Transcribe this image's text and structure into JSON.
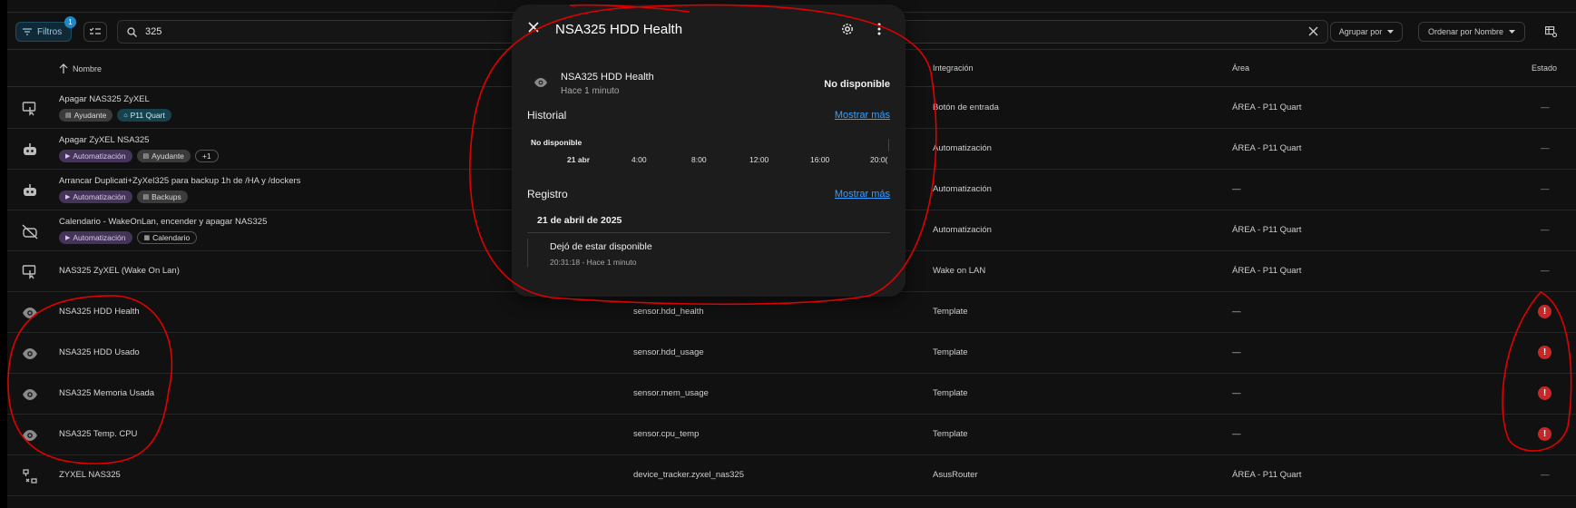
{
  "toolbar": {
    "filters_label": "Filtros",
    "filters_badge": "1",
    "search_value": "325",
    "group_label": "Agrupar por",
    "sort_label": "Ordenar por Nombre"
  },
  "table": {
    "headers": {
      "name": "Nombre",
      "integration": "Integración",
      "area": "Área",
      "state": "Estado"
    },
    "rows": [
      {
        "icon": "button-press-icon",
        "name": "Apagar NAS325 ZyXEL",
        "entity_id": "",
        "integration": "Botón de entrada",
        "area": "ÁREA - P11 Quart",
        "state": "—",
        "labels": [
          {
            "text": "Ayudante",
            "style": "gray"
          },
          {
            "text": "P11 Quart",
            "style": "teal"
          }
        ]
      },
      {
        "icon": "robot-icon",
        "name": "Apagar ZyXEL NSA325",
        "entity_id": "",
        "integration": "Automatización",
        "area": "ÁREA - P11 Quart",
        "state": "—",
        "labels": [
          {
            "text": "Automatización",
            "style": "purple"
          },
          {
            "text": "Ayudante",
            "style": "gray"
          },
          {
            "text": "+1",
            "style": "outline"
          }
        ]
      },
      {
        "icon": "robot-icon",
        "name": "Arrancar Duplicati+ZyXel325 para backup 1h de /HA y /dockers",
        "entity_id": "",
        "integration": "Automatización",
        "area": "—",
        "state": "—",
        "labels": [
          {
            "text": "Automatización",
            "style": "purple"
          },
          {
            "text": "Backups",
            "style": "gray"
          }
        ]
      },
      {
        "icon": "robot-off-icon",
        "name": "Calendario - WakeOnLan, encender y apagar NAS325",
        "entity_id": "",
        "integration": "Automatización",
        "area": "ÁREA - P11 Quart",
        "state": "—",
        "labels": [
          {
            "text": "Automatización",
            "style": "purple"
          },
          {
            "text": "Calendario",
            "style": "outline"
          }
        ]
      },
      {
        "icon": "button-press-icon",
        "name": "NAS325 ZyXEL (Wake On Lan)",
        "entity_id": "",
        "integration": "Wake on LAN",
        "area": "ÁREA - P11 Quart",
        "state": "—",
        "labels": []
      },
      {
        "icon": "eye-icon",
        "name": "NSA325 HDD Health",
        "entity_id": "sensor.hdd_health",
        "integration": "Template",
        "area": "—",
        "state": "!",
        "labels": []
      },
      {
        "icon": "eye-icon",
        "name": "NSA325 HDD Usado",
        "entity_id": "sensor.hdd_usage",
        "integration": "Template",
        "area": "—",
        "state": "!",
        "labels": []
      },
      {
        "icon": "eye-icon",
        "name": "NSA325 Memoria Usada",
        "entity_id": "sensor.mem_usage",
        "integration": "Template",
        "area": "—",
        "state": "!",
        "labels": []
      },
      {
        "icon": "eye-icon",
        "name": "NSA325 Temp. CPU",
        "entity_id": "sensor.cpu_temp",
        "integration": "Template",
        "area": "—",
        "state": "!",
        "labels": []
      },
      {
        "icon": "lan-disconnect-icon",
        "name": "ZYXEL NAS325",
        "entity_id": "device_tracker.zyxel_nas325",
        "integration": "AsusRouter",
        "area": "ÁREA - P11 Quart",
        "state": "—",
        "labels": []
      }
    ]
  },
  "dialog": {
    "title": "NSA325 HDD Health",
    "entity_name": "NSA325 HDD Health",
    "entity_sub": "Hace 1 minuto",
    "entity_state": "No disponible",
    "history_title": "Historial",
    "history_link": "Mostrar más",
    "history_state_label": "No disponible",
    "history_ticks": [
      "21 abr",
      "4:00",
      "8:00",
      "12:00",
      "16:00",
      "20:0("
    ],
    "logbook_title": "Registro",
    "logbook_link": "Mostrar más",
    "logbook_date": "21 de abril de 2025",
    "logbook_event": "Dejó de estar disponible",
    "logbook_time": "20:31:18 - Hace 1 minuto"
  },
  "colors": {
    "annotation": "#e00000",
    "alert": "#c62828",
    "link": "#3aa0ff"
  }
}
